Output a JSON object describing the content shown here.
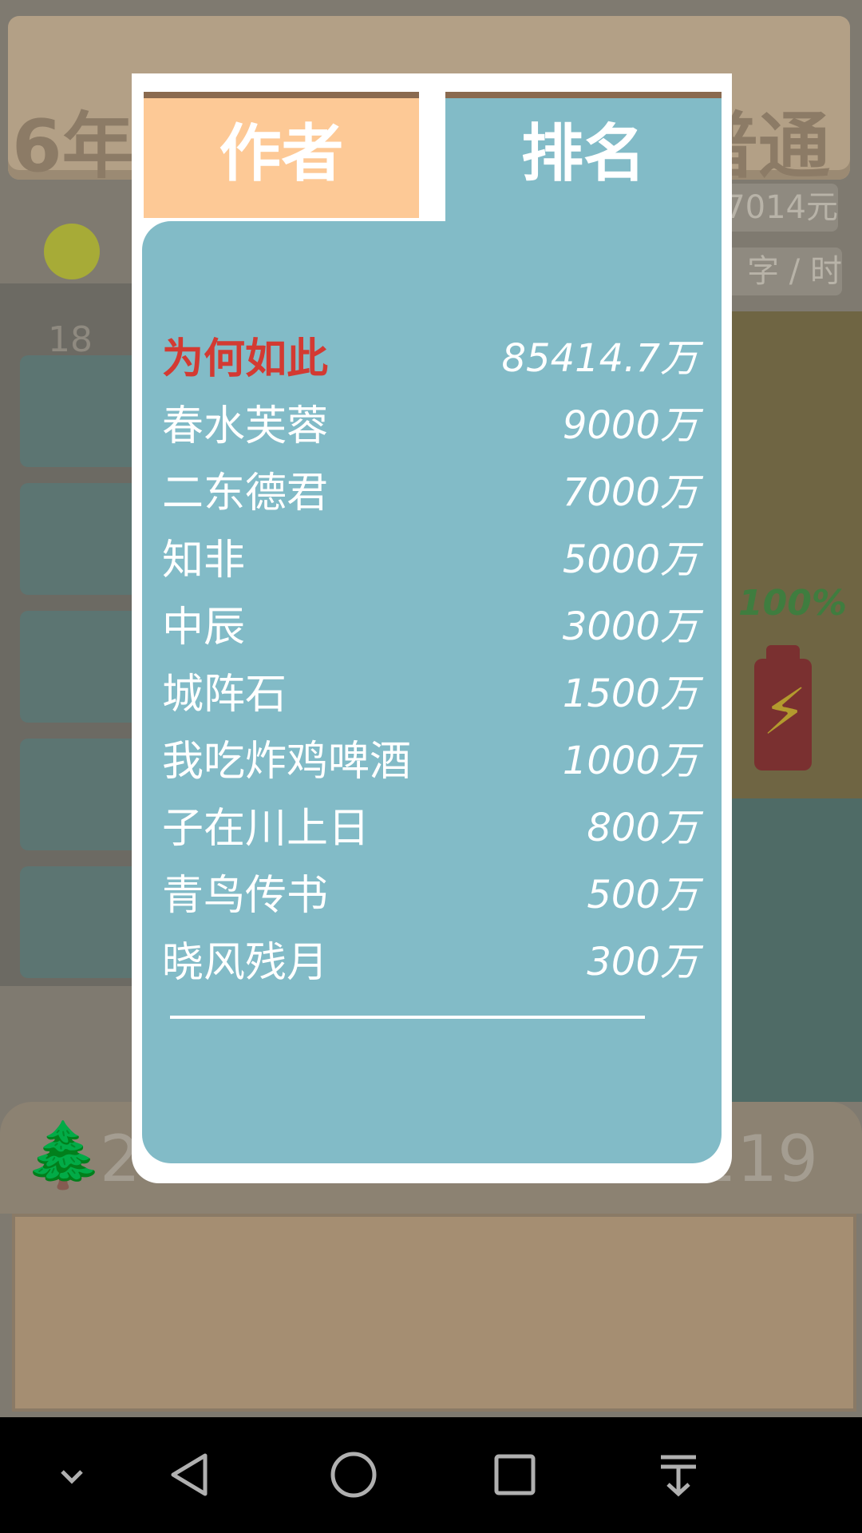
{
  "background": {
    "top_left_partial": "6年1",
    "top_right_partial": "普通",
    "money_partial": "7014元",
    "speed_partial": "字 / 时",
    "bulb_count_partial": "18",
    "battery_percent": "100%",
    "bottom_left_partial": "2",
    "bottom_right_partial": "219"
  },
  "tabs": {
    "author": "作者",
    "ranking": "排名"
  },
  "ranking": [
    {
      "name": "为何如此",
      "value": "85414.7万"
    },
    {
      "name": "春水芙蓉",
      "value": "9000万"
    },
    {
      "name": "二东德君",
      "value": "7000万"
    },
    {
      "name": "知非",
      "value": "5000万"
    },
    {
      "name": "中辰",
      "value": "3000万"
    },
    {
      "name": "城阵石",
      "value": "1500万"
    },
    {
      "name": "我吃炸鸡啤酒",
      "value": "1000万"
    },
    {
      "name": "子在川上日",
      "value": "800万"
    },
    {
      "name": "青鸟传书",
      "value": "500万"
    },
    {
      "name": "晓风残月",
      "value": "300万"
    }
  ],
  "colors": {
    "highlight_name": "#d33a32",
    "tab_author": "#fdc996",
    "tab_ranking": "#82bbc7",
    "battery_text": "#3f7d3f"
  },
  "icons": {
    "bulb": "lightbulb-icon",
    "battery": "battery-icon",
    "tree": "tree-icon",
    "nav": [
      "chevron-down-icon",
      "back-icon",
      "home-icon",
      "recent-apps-icon",
      "pull-down-icon"
    ]
  }
}
